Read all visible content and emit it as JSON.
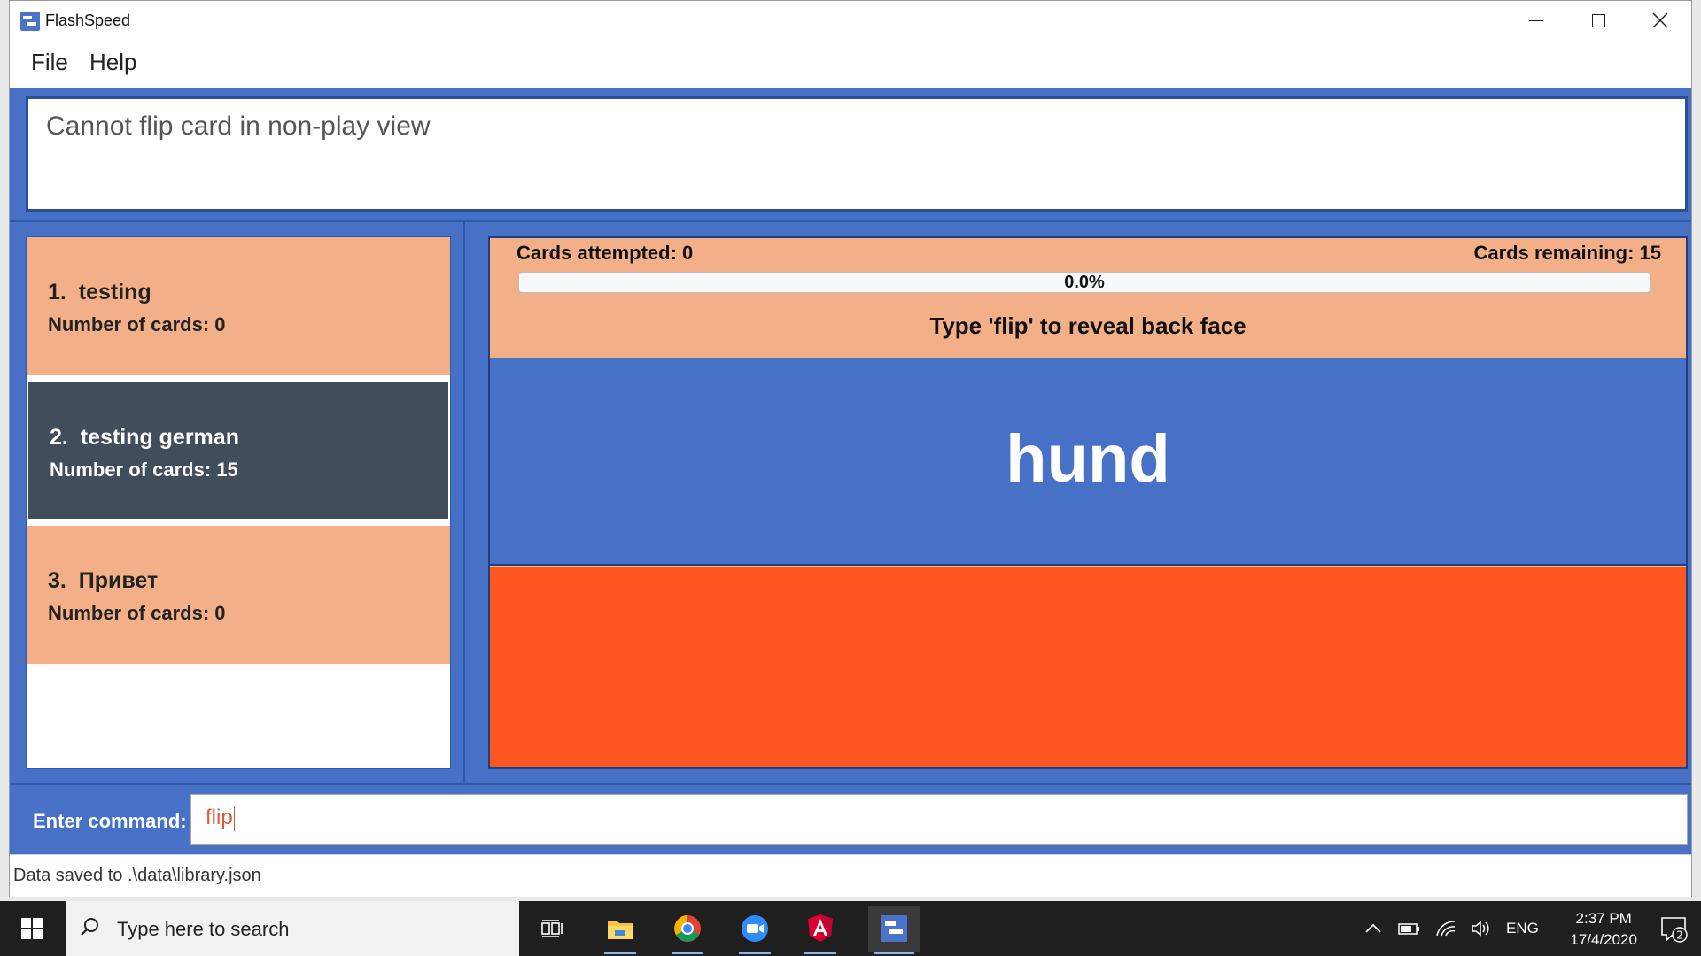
{
  "window": {
    "title": "FlashSpeed",
    "menu": {
      "file": "File",
      "help": "Help"
    }
  },
  "result": {
    "message": "Cannot flip card in non-play view"
  },
  "decks": [
    {
      "index": "1.",
      "name": "testing",
      "count_label": "Number of cards: 0",
      "selected": false
    },
    {
      "index": "2.",
      "name": "testing german",
      "count_label": "Number of cards: 15",
      "selected": true
    },
    {
      "index": "3.",
      "name": "Привет",
      "count_label": "Number of cards: 0",
      "selected": false
    }
  ],
  "play": {
    "attempted": "Cards attempted: 0",
    "remaining": "Cards remaining: 15",
    "progress_value": 0.0,
    "progress_text": "0.0%",
    "hint": "Type 'flip' to reveal back face",
    "front": "hund",
    "back": "",
    "colors": {
      "front": "#4671c6",
      "back": "#ff5722",
      "stats": "#f3b088"
    }
  },
  "command": {
    "label": "Enter command:",
    "value": "flip"
  },
  "status": {
    "text": "Data saved to .\\data\\library.json"
  },
  "taskbar": {
    "search_placeholder": "Type here to search",
    "language": "ENG",
    "time": "2:37 PM",
    "date": "17/4/2020",
    "notification_count": "2",
    "pinned": [
      "task-view-icon",
      "file-explorer-icon",
      "chrome-icon",
      "zoom-icon",
      "angular-icon",
      "flashspeed-icon"
    ]
  }
}
